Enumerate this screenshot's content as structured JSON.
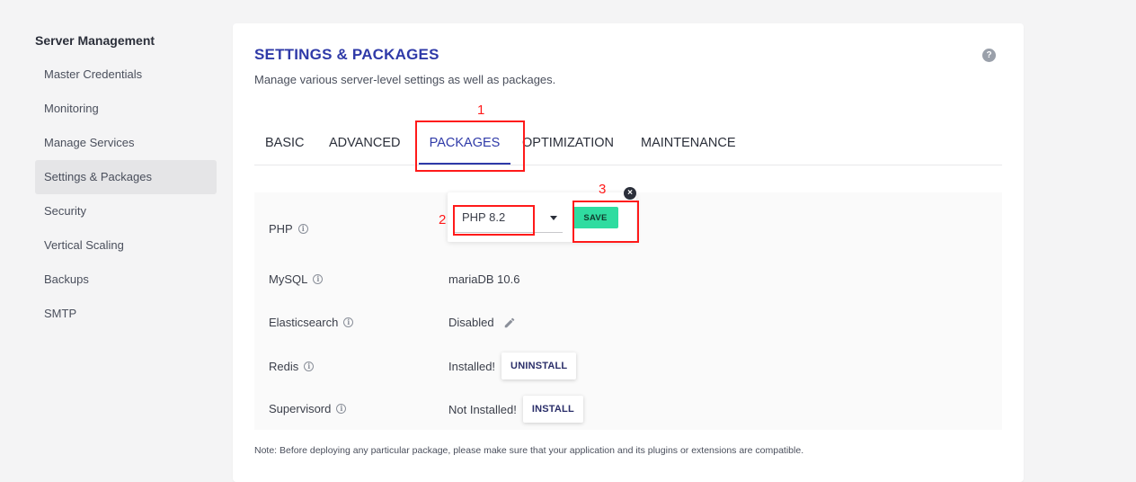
{
  "sidebar": {
    "title": "Server Management",
    "items": [
      {
        "label": "Master Credentials"
      },
      {
        "label": "Monitoring"
      },
      {
        "label": "Manage Services"
      },
      {
        "label": "Settings & Packages"
      },
      {
        "label": "Security"
      },
      {
        "label": "Vertical Scaling"
      },
      {
        "label": "Backups"
      },
      {
        "label": "SMTP"
      }
    ],
    "active_index": 3
  },
  "card": {
    "title": "SETTINGS & PACKAGES",
    "subtitle": "Manage various server-level settings as well as packages.",
    "help_glyph": "?"
  },
  "tabs": [
    {
      "label": "BASIC"
    },
    {
      "label": "ADVANCED"
    },
    {
      "label": "PACKAGES"
    },
    {
      "label": "OPTIMIZATION"
    },
    {
      "label": "MAINTENANCE"
    }
  ],
  "active_tab": "PACKAGES",
  "packages": {
    "php": {
      "label": "PHP",
      "selected": "PHP 8.2",
      "save_label": "SAVE"
    },
    "mysql": {
      "label": "MySQL",
      "value": "mariaDB 10.6"
    },
    "elasticsearch": {
      "label": "Elasticsearch",
      "value": "Disabled"
    },
    "redis": {
      "label": "Redis",
      "value": "Installed!",
      "action": "UNINSTALL"
    },
    "supervisord": {
      "label": "Supervisord",
      "value": "Not Installed!",
      "action": "INSTALL"
    }
  },
  "note": "Note: Before deploying any particular package, please make sure that your application and its plugins or extensions are compatible.",
  "annotations": {
    "one": "1",
    "two": "2",
    "three": "3",
    "color": "#ff1a1a"
  },
  "colors": {
    "accent": "#2f3aa8",
    "save_button": "#2fdca0"
  }
}
